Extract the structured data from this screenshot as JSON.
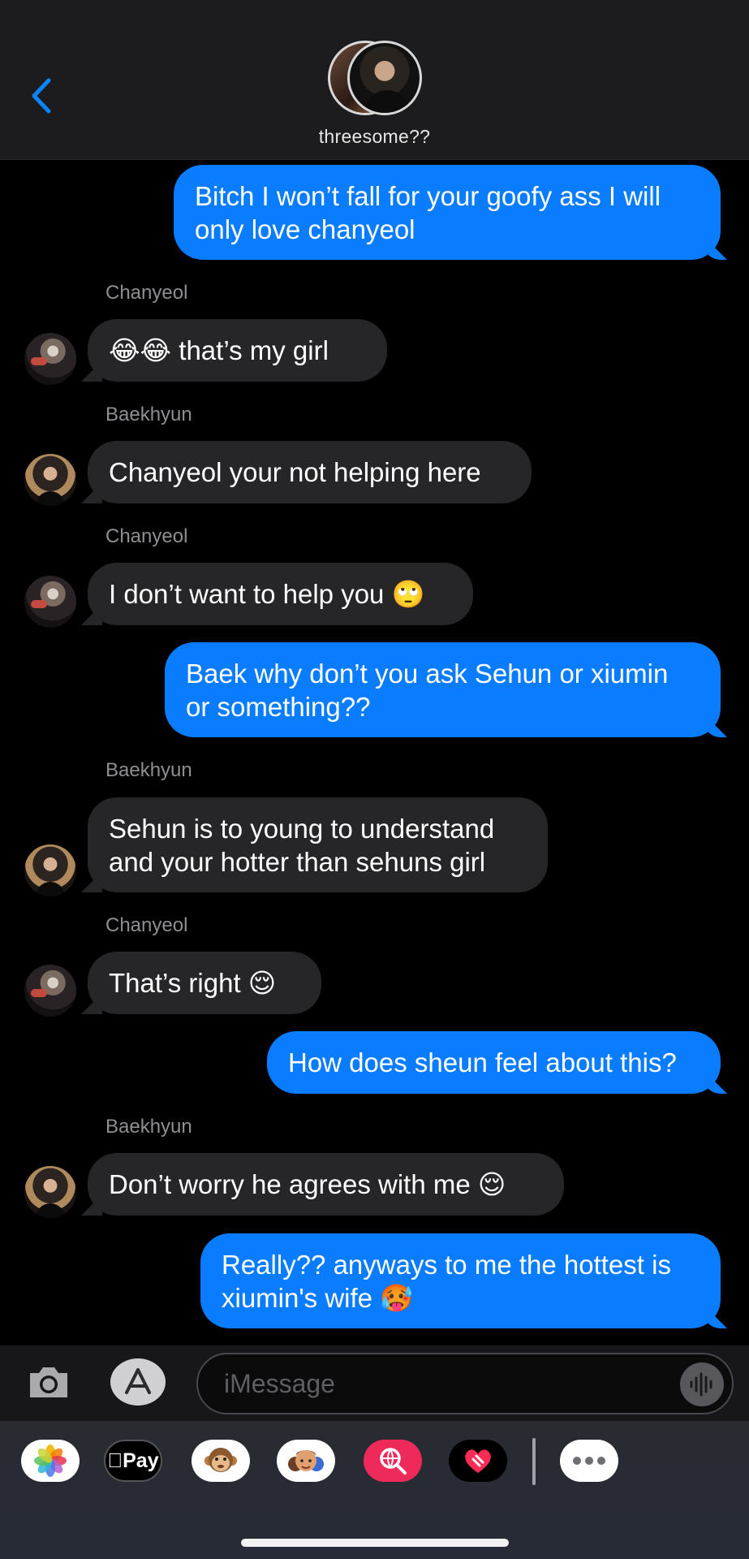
{
  "header": {
    "group_name": "threesome??"
  },
  "messages": [
    {
      "direction": "out",
      "text": "Bitch I won’t fall for your goofy ass I will\nonly love chanyeol"
    },
    {
      "direction": "in",
      "sender": "Chanyeol",
      "text": "😂😂 that’s my girl"
    },
    {
      "direction": "in",
      "sender": "Baekhyun",
      "text": "Chanyeol your not helping here"
    },
    {
      "direction": "in",
      "sender": "Chanyeol",
      "text": "I don’t want to help you 🙄"
    },
    {
      "direction": "out",
      "text": "Baek why don’t you ask Sehun or xiumin\nor something??"
    },
    {
      "direction": "in",
      "sender": "Baekhyun",
      "text": "Sehun is to young to understand\nand your hotter than sehuns girl"
    },
    {
      "direction": "in",
      "sender": "Chanyeol",
      "text": "That’s right 😌"
    },
    {
      "direction": "out",
      "text": "How does sheun feel about this?"
    },
    {
      "direction": "in",
      "sender": "Baekhyun",
      "text": "Don’t worry he agrees with me 😌"
    },
    {
      "direction": "out",
      "text": "Really?? anyways to me the hottest is\nxiumin's wife 🥵"
    }
  ],
  "input": {
    "placeholder": "iMessage"
  },
  "apps": {
    "applepay_label": "Pay"
  },
  "colors": {
    "accent": "#0a7cff",
    "incoming_bubble": "#262628",
    "background": "#000000"
  }
}
